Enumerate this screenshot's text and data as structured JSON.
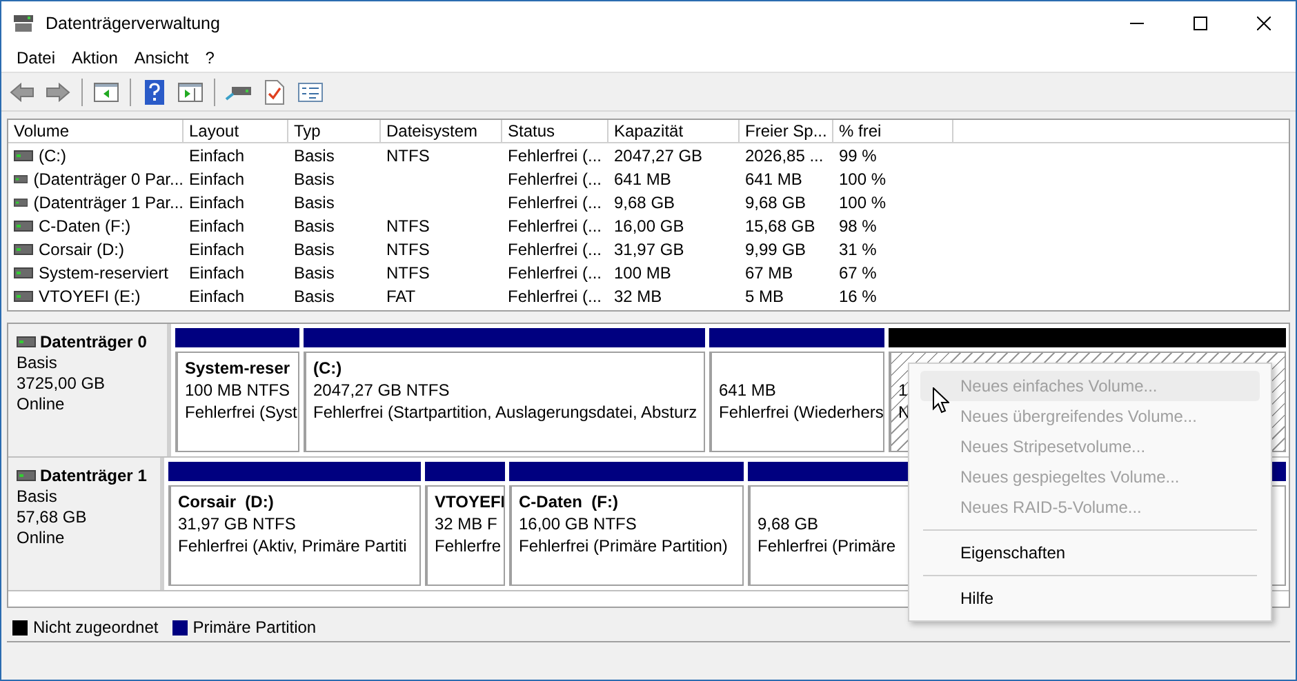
{
  "window": {
    "title": "Datenträgerverwaltung"
  },
  "menu_bar": [
    "Datei",
    "Aktion",
    "Ansicht",
    "?"
  ],
  "table": {
    "columns": [
      "Volume",
      "Layout",
      "Typ",
      "Dateisystem",
      "Status",
      "Kapazität",
      "Freier Sp...",
      "% frei"
    ],
    "rows": [
      {
        "cells": [
          "(C:)",
          "Einfach",
          "Basis",
          "NTFS",
          "Fehlerfrei (...",
          "2047,27 GB",
          "2026,85 ...",
          "99 %"
        ]
      },
      {
        "cells": [
          "(Datenträger 0 Par...",
          "Einfach",
          "Basis",
          "",
          "Fehlerfrei (...",
          "641 MB",
          "641 MB",
          "100 %"
        ]
      },
      {
        "cells": [
          "(Datenträger 1 Par...",
          "Einfach",
          "Basis",
          "",
          "Fehlerfrei (...",
          "9,68 GB",
          "9,68 GB",
          "100 %"
        ]
      },
      {
        "cells": [
          "C-Daten (F:)",
          "Einfach",
          "Basis",
          "NTFS",
          "Fehlerfrei (...",
          "16,00 GB",
          "15,68 GB",
          "98 %"
        ]
      },
      {
        "cells": [
          "Corsair (D:)",
          "Einfach",
          "Basis",
          "NTFS",
          "Fehlerfrei (...",
          "31,97 GB",
          "9,99 GB",
          "31 %"
        ]
      },
      {
        "cells": [
          "System-reserviert",
          "Einfach",
          "Basis",
          "NTFS",
          "Fehlerfrei (...",
          "100 MB",
          "67 MB",
          "67 %"
        ]
      },
      {
        "cells": [
          "VTOYEFI (E:)",
          "Einfach",
          "Basis",
          "FAT",
          "Fehlerfrei (...",
          "32 MB",
          "5 MB",
          "16 %"
        ]
      }
    ]
  },
  "disks": [
    {
      "name": "Datenträger 0",
      "type": "Basis",
      "size": "3725,00 GB",
      "status": "Online",
      "partitions": [
        {
          "kind": "primary",
          "name": "System-reser",
          "size": "100 MB NTFS",
          "status": "Fehlerfrei (Syst"
        },
        {
          "kind": "primary",
          "name": "(C:)",
          "size": "2047,27 GB NTFS",
          "status": "Fehlerfrei (Startpartition, Auslagerungsdatei, Absturz"
        },
        {
          "kind": "primary",
          "size": "641 MB",
          "status": "Fehlerfrei (Wiederhers"
        },
        {
          "kind": "unallocated",
          "size": "1",
          "status": "N"
        }
      ]
    },
    {
      "name": "Datenträger 1",
      "type": "Basis",
      "size": "57,68 GB",
      "status": "Online",
      "partitions": [
        {
          "kind": "primary",
          "name": "Corsair  (D:)",
          "size": "31,97 GB NTFS",
          "status": "Fehlerfrei (Aktiv, Primäre Partiti"
        },
        {
          "kind": "primary",
          "name": "VTOYEFI",
          "size": "32 MB F",
          "status": "Fehlerfre"
        },
        {
          "kind": "primary",
          "name": "C-Daten  (F:)",
          "size": "16,00 GB NTFS",
          "status": "Fehlerfrei (Primäre Partition)"
        },
        {
          "kind": "primary",
          "size": "9,68 GB",
          "status": "Fehlerfrei (Primäre"
        }
      ]
    }
  ],
  "legend": [
    {
      "label": "Nicht zugeordnet",
      "color": "#000000"
    },
    {
      "label": "Primäre Partition",
      "color": "#000080"
    }
  ],
  "context_menu": {
    "items": [
      {
        "kind": "item",
        "label": "Neues einfaches Volume...",
        "disabled": true,
        "selected": true
      },
      {
        "kind": "item",
        "label": "Neues übergreifendes Volume...",
        "disabled": true,
        "selected": false
      },
      {
        "kind": "item",
        "label": "Neues Stripesetvolume...",
        "disabled": true,
        "selected": false
      },
      {
        "kind": "item",
        "label": "Neues gespiegeltes Volume...",
        "disabled": true,
        "selected": false
      },
      {
        "kind": "item",
        "label": "Neues RAID-5-Volume...",
        "disabled": true,
        "selected": false
      },
      {
        "kind": "separator"
      },
      {
        "kind": "item",
        "label": "Eigenschaften",
        "disabled": false,
        "selected": false
      },
      {
        "kind": "separator"
      },
      {
        "kind": "item",
        "label": "Hilfe",
        "disabled": false,
        "selected": false
      }
    ]
  }
}
